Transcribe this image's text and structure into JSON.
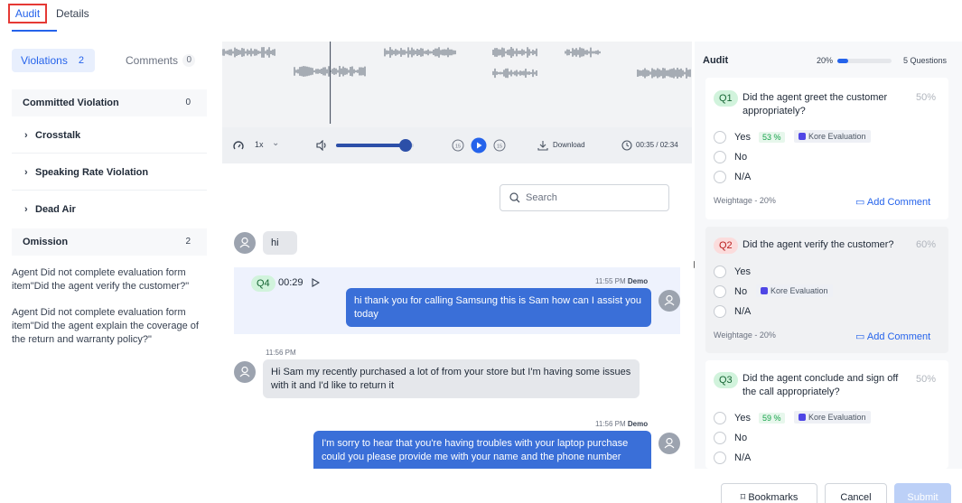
{
  "tabs": {
    "audit": "Audit",
    "details": "Details"
  },
  "left": {
    "violations_label": "Violations",
    "violations_count": "2",
    "comments_label": "Comments",
    "comments_count": "0",
    "committed": {
      "label": "Committed Violation",
      "count": "0"
    },
    "items": [
      "Crosstalk",
      "Speaking Rate Violation",
      "Dead Air"
    ],
    "omission": {
      "label": "Omission",
      "count": "2"
    },
    "omission_texts": [
      "Agent Did not complete evaluation form item\"Did the agent verify the customer?\"",
      "Agent Did not complete evaluation form item\"Did the agent explain the coverage of the return and warranty policy?\""
    ]
  },
  "player": {
    "speed": "1x",
    "download": "Download",
    "time": "00:35 / 02:34",
    "progress": 0.23,
    "volume": 0.9,
    "skip_back": "15",
    "skip_fwd": "15"
  },
  "chat": {
    "search_placeholder": "Search",
    "msg1": "hi",
    "q4": {
      "badge": "Q4",
      "time": "00:29"
    },
    "msg2_stamp": "11:55 PM",
    "msg2_who": "Demo",
    "msg2": "hi thank you for calling Samsung this is Sam how can I assist you today",
    "msg3_stamp": "11:56 PM",
    "msg3": "Hi Sam my recently purchased a lot of from your store but I'm having some issues with it and I'd like to return it",
    "msg4_stamp": "11:56 PM",
    "msg4_who": "Demo",
    "msg4": "I'm sorry to hear that you're having troubles with your laptop purchase could you please provide me with your name and the phone number"
  },
  "audit": {
    "title": "Audit",
    "progress_label": "20%",
    "progress": 0.2,
    "questions": "5 Questions",
    "kore": "Kore Evaluation",
    "weightage": "Weightage - 20%",
    "add_comment": "Add Comment",
    "q1": {
      "badge": "Q1",
      "text": "Did the agent greet the customer appropriately?",
      "pct": "50%",
      "yes": "Yes",
      "no": "No",
      "na": "N/A",
      "score": "53 %"
    },
    "q2": {
      "badge": "Q2",
      "text": "Did the agent verify the customer?",
      "pct": "60%",
      "yes": "Yes",
      "no": "No",
      "na": "N/A"
    },
    "q3": {
      "badge": "Q3",
      "text": "Did the agent conclude and sign off the call appropriately?",
      "pct": "50%",
      "yes": "Yes",
      "no": "No",
      "na": "N/A",
      "score": "59 %"
    }
  },
  "footer": {
    "bookmarks": "Bookmarks",
    "cancel": "Cancel",
    "submit": "Submit"
  },
  "colors": {
    "accent": "#2563eb",
    "bubble": "#3a6fd8",
    "highlight": "#e53935"
  }
}
